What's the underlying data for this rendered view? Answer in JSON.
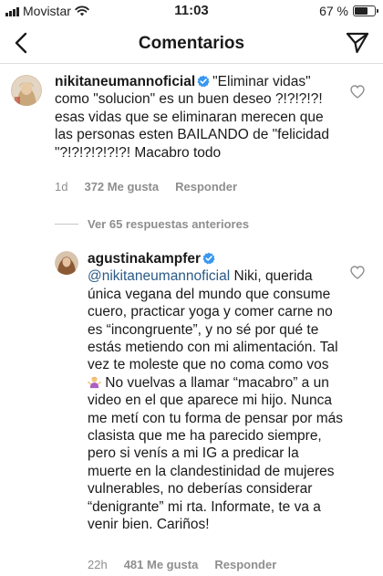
{
  "status_bar": {
    "carrier": "Movistar",
    "time": "11:03",
    "battery_text": "67 %",
    "battery_level": 0.67
  },
  "header": {
    "title": "Comentarios",
    "back_icon": "chevron-left-icon",
    "send_icon": "paper-plane-icon"
  },
  "comments": [
    {
      "username": "nikitaneumannoficial",
      "text": "\"Eliminar vidas\" como \"solucion\" es un buen deseo ?!?!?!?! esas vidas que se eliminaran merecen que las personas esten BAILANDO de \"felicidad \"?!?!?!?!?!?! Macabro todo",
      "time": "1d",
      "likes": "372 Me gusta",
      "reply_label": "Responder"
    },
    {
      "username": "agustinakampfer",
      "mention": "@nikitaneumannoficial",
      "text_before_emoji": " Niki, querida única vegana del mundo que consume cuero, practicar yoga y comer carne no es “incongruente”, y no sé por qué te estás metiendo con mi alimentación. Tal vez te moleste que no coma como vos ",
      "text_after_emoji": " No vuelvas a llamar “macabro” a un video en el que aparece mi hijo. Nunca me metí con tu forma de pensar por más clasista que me ha parecido siempre, pero si venís a mi IG a predicar la muerte en la clandestinidad de mujeres vulnerables, no deberías considerar “denigrante” mi rta. Informate, te va a venir bien. Cariños!",
      "time": "22h",
      "likes": "481 Me gusta",
      "reply_label": "Responder"
    }
  ],
  "view_replies_label": "Ver 65 respuestas anteriores",
  "colors": {
    "mention": "#2b5a87",
    "verified": "#3897f0",
    "meta": "#8e8e8e"
  }
}
